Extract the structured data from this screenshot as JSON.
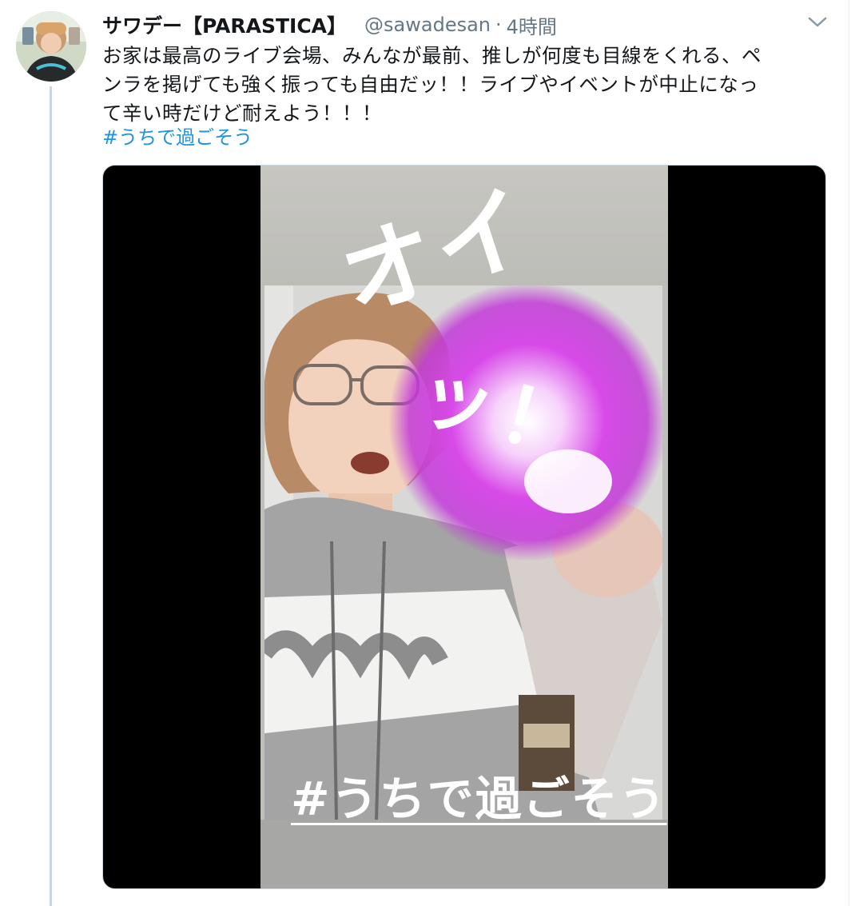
{
  "tweet": {
    "author_name": "サワデー【PARASTICA】",
    "handle": "@sawadesan",
    "separator": "·",
    "time": "4時間",
    "body_lines": [
      "お家は最高のライブ会場、みんなが最前、推しが何度も目線をくれる、ペ",
      "ンラを掲げても強く振っても自由だッ！！ライブやイベントが中止になっ",
      "て辛い時だけど耐えよう！！！"
    ],
    "hashtag": "#うちで過ごそう"
  },
  "media": {
    "overlay_top": "オイ",
    "overlay_middle": "ッ！",
    "overlay_caption": "#うちで過ごそう"
  },
  "icons": {
    "menu": "chevron-down-icon",
    "avatar": "avatar"
  },
  "colors": {
    "text": "#14171a",
    "secondary": "#657786",
    "link": "#1b95e0",
    "thread_line": "#ccd6dd",
    "effect": "#d64ae6"
  }
}
